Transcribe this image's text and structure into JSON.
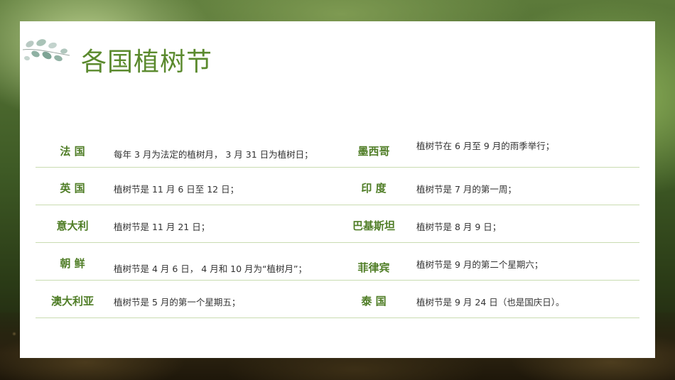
{
  "page": {
    "title": "各国植树节",
    "accent_color": "#5b8a2e",
    "country_color": "#4f7d26",
    "divider_color": "#c9dcb1"
  },
  "decoration": {
    "icon": "eucalyptus-leaf-icon"
  },
  "rows": [
    {
      "left": {
        "country": "法 国",
        "desc": "每年 3 月为法定的植树月， 3 月 31 日为植树日；"
      },
      "right": {
        "country": "墨西哥",
        "desc": "植树节在 6 月至 9 月的雨季举行；"
      }
    },
    {
      "left": {
        "country": "英 国",
        "desc": "植树节是 11 月 6 日至 12 日；"
      },
      "right": {
        "country": "印 度",
        "desc": "植树节是 7 月的第一周；"
      }
    },
    {
      "left": {
        "country": "意大利",
        "desc": "植树节是 11 月 21 日；"
      },
      "right": {
        "country": "巴基斯坦",
        "desc": "植树节是 8 月 9 日；"
      }
    },
    {
      "left": {
        "country": "朝 鲜",
        "desc": "植树节是 4 月 6 日， 4 月和 10 月为“植树月”；"
      },
      "right": {
        "country": "菲律宾",
        "desc": "植树节是 9 月的第二个星期六；"
      }
    },
    {
      "left": {
        "country": "澳大利亚",
        "desc": "植树节是 5 月的第一个星期五；"
      },
      "right": {
        "country": "泰 国",
        "desc": "植树节是 9 月 24 日（也是国庆日）。"
      }
    }
  ]
}
